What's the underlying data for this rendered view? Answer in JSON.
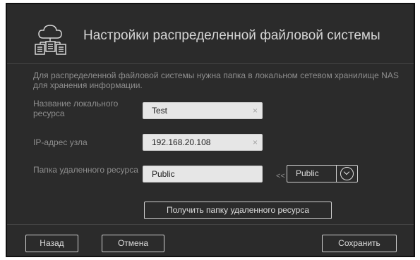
{
  "dialog": {
    "title": "Настройки распределенной файловой системы",
    "description": "Для распределенной файловой системы нужна папка в локальном сетевом хранилище NAS для хранения информации.",
    "fields": {
      "local_name": {
        "label": "Название локального ресурса",
        "value": "Test",
        "clear_glyph": "×"
      },
      "ip": {
        "label": "IP-адрес узла",
        "value": "192.168.20.108",
        "clear_glyph": "×"
      },
      "remote_folder": {
        "label": "Папка удаленного ресурса",
        "value": "Public",
        "arrow": "<<",
        "select_value": "Public"
      }
    },
    "fetch_button": "Получить папку удаленного ресурса",
    "footer": {
      "back": "Назад",
      "cancel": "Отмена",
      "save": "Сохранить"
    }
  },
  "icons": {
    "app": "cloud-network-icon",
    "clear": "close-icon",
    "dropdown": "chevron-down-icon"
  },
  "colors": {
    "background": "#2b2b2b",
    "input_fill": "#e6e6e6",
    "muted_text": "#8e8e8e",
    "title_text": "#d4d4d4"
  }
}
